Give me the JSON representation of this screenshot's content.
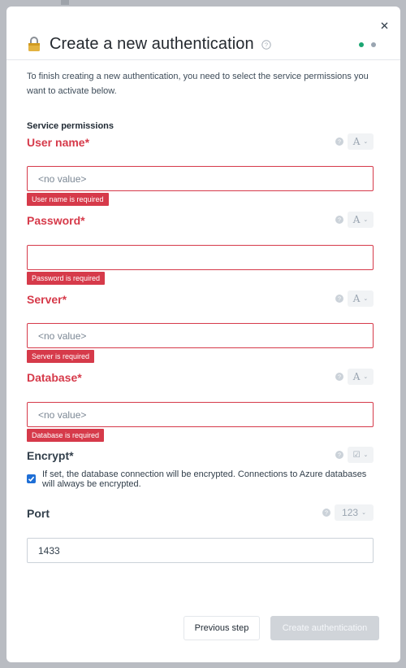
{
  "modal": {
    "title": "Create a new authentication",
    "intro": "To finish creating a new authentication, you need to select the service permissions you want to activate below.",
    "section_title": "Service permissions"
  },
  "colors": {
    "error": "#d63a4a",
    "step_done": "#1ba672",
    "step_pending": "#9aa5b1",
    "checkbox": "#1f6fd6"
  },
  "icons": {
    "lock": "lock-icon",
    "help": "help-icon",
    "close": "close-icon"
  },
  "fields": [
    {
      "label": "User name*",
      "type_symbol": "A",
      "value": "<no value>",
      "error": "User name is required"
    },
    {
      "label": "Password*",
      "type_symbol": "A",
      "value": "",
      "error": "Password is required"
    },
    {
      "label": "Server*",
      "type_symbol": "A",
      "value": "<no value>",
      "error": "Server is required"
    },
    {
      "label": "Database*",
      "type_symbol": "A",
      "value": "<no value>",
      "error": "Database is required"
    },
    {
      "label": "Encrypt*",
      "type_symbol": "☑",
      "checked": true,
      "description": "If set, the database connection will be encrypted. Connections to Azure databases will always be encrypted."
    },
    {
      "label": "Port",
      "type_symbol": "123",
      "value": "1433"
    }
  ],
  "buttons": {
    "previous": "Previous step",
    "create": "Create authentication"
  }
}
